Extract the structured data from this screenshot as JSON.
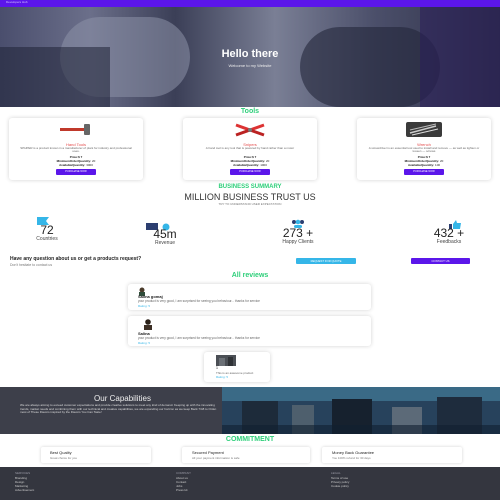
{
  "topbar": {
    "brand": "Developers Hub"
  },
  "hero": {
    "title": "Hello there",
    "subtitle": "Welcome to my Website"
  },
  "tools": {
    "title": "Tools",
    "items": [
      {
        "name": "Hand Tools",
        "desc": "SPHPER is a product known in a manufacturer of plant for industry and professional uses.",
        "price": "Price:$ 7",
        "min_label": "MinimumOrderQuantity:",
        "min": "20",
        "avail_label": "AvailableQuantity:",
        "avail": "3000",
        "button": "PURCHASE NOW"
      },
      {
        "name": "Snipers",
        "desc": "A hand tool is any tool that is powered by hand rather than a motor",
        "price": "Price:$ 7",
        "min_label": "MinimumOrderQuantity:",
        "min": "20",
        "avail_label": "AvailableQuantity:",
        "avail": "1000",
        "button": "PURCHASE NOW"
      },
      {
        "name": "Wrench",
        "desc": "A screwdriver is an essential tool used to install and remove — as well as tighten or loosen — screws",
        "price": "Price:$ 7",
        "min_label": "MinimumOrderQuantity:",
        "min": "20",
        "avail_label": "AvailableQuantity:",
        "avail": "100",
        "button": "PURCHASE NOW"
      }
    ]
  },
  "summary": {
    "title": "BUSINESS SUMMARY",
    "headline": "MILLION BUSINESS TRUST US",
    "sub": "TRY TO UNDERSTAND USER EXPECTATION",
    "stats": [
      {
        "num": "72",
        "label": "Countries"
      },
      {
        "num": "45m",
        "label": "Revenue"
      },
      {
        "num": "273 +",
        "label": "Happy Clients"
      },
      {
        "num": "432 +",
        "label": "Feedbacks"
      }
    ],
    "question": "Have any question about us or get a products request?",
    "question_sub": "Don't hesitate to contact us",
    "request_btn": "REQUEST FOR QUOTE",
    "contact_btn": "CONTACT US"
  },
  "reviews": {
    "title": "All reviews",
    "items": [
      {
        "name": "Salina gomaj",
        "text": "your product is very good, I am surprised for seeing you behaviour... thanks for service",
        "rating": "Rating: 5"
      },
      {
        "name": "Salina",
        "text": "your product is very good, I am surprised for seeing you behaviour... thanks for service",
        "rating": "Rating: 5"
      },
      {
        "name": "1",
        "text": "This is an awesome product",
        "rating": "Rating: 5"
      }
    ]
  },
  "capabilities": {
    "title": "Our Capabilities",
    "text": "We are always aiming to exceed customer expectations and provide creative solutions to meet any kind of demand. Keeping up with the innovating trends, market needs and combining them with our technical and creative capabilities, we are expanding our horizon as we keep Back 7/48 to Order. most of These Flavors inspired by the Flavors You Can Taste!"
  },
  "commitment": {
    "title": "COMMITMENT",
    "items": [
      {
        "title": "Best Quality",
        "sub": "Great choice for you"
      },
      {
        "title": "Secured Payment",
        "sub": "All your payment information is safe"
      },
      {
        "title": "Money Back Guarantee",
        "sub": "You 100% refund for 30 days"
      }
    ]
  },
  "footer": {
    "cols": [
      {
        "head": "SERVICES",
        "items": [
          "Branding",
          "Design",
          "Marketing",
          "Advertisement"
        ]
      },
      {
        "head": "COMPANY",
        "items": [
          "About us",
          "Contact",
          "Jobs",
          "Press kit"
        ]
      },
      {
        "head": "LEGAL",
        "items": [
          "Terms of use",
          "Privacy policy",
          "Cookie policy"
        ]
      }
    ]
  },
  "colors": {
    "accent": "#5b16ea",
    "green": "#2ecf7a",
    "sky": "#35b6e8"
  }
}
